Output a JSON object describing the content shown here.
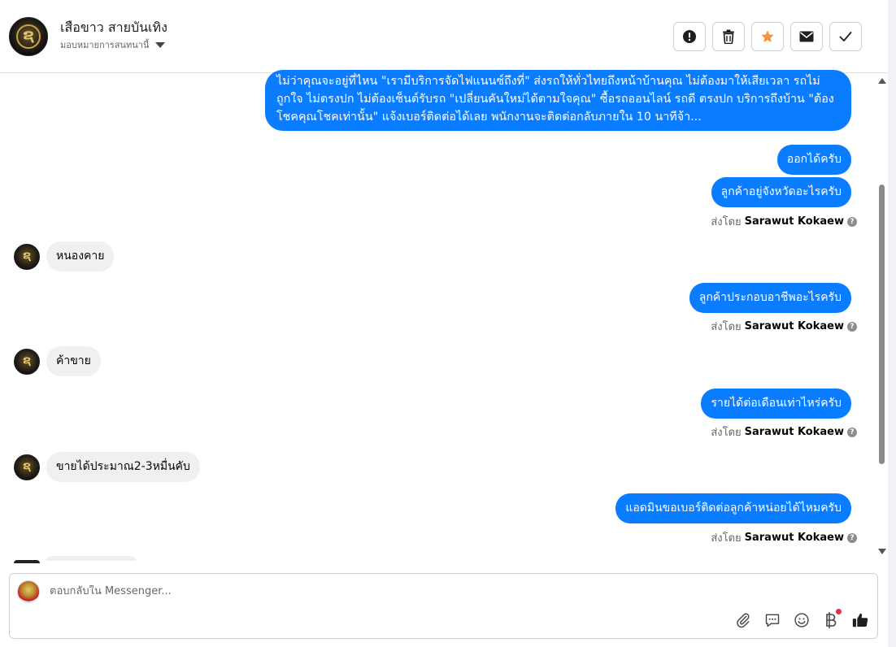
{
  "header": {
    "page_name": "เสือขาว สายบันเทิง",
    "assign_label": "มอบหมายการสนทนานี้",
    "actions": [
      {
        "name": "mark-spam-button",
        "icon": "exclamation-circle-icon"
      },
      {
        "name": "delete-button",
        "icon": "trash-icon"
      },
      {
        "name": "star-button",
        "icon": "star-icon",
        "color": "#f7923a"
      },
      {
        "name": "mark-unread-button",
        "icon": "envelope-icon"
      },
      {
        "name": "mark-done-button",
        "icon": "check-icon"
      }
    ]
  },
  "messages": {
    "long_outgoing": "ไม่ว่าคุณจะอยู่ที่ไหน \"เรามีบริการจัดไฟแนนซ์ถึงที่\"  ส่งรถให้ทั่วไทยถึงหน้าบ้านคุณ ไม่ต้องมาให้เสียเวลา รถไม่ถูกใจ ไม่ตรงปก ไม่ต้องเซ็นต์รับรถ \"เปลี่ยนคันใหม่ได้ตามใจคุณ\" ซื้อรถออนไลน์ รถดี ตรงปก บริการถึงบ้าน \"ต้องโชคคุณโชคเท่านั้น\" แจ้งเบอร์ติดต่อได้เลย พนักงานจะติดต่อกลับภายใน 10 นาทีจ้า...",
    "out_1": "ออกได้ครับ",
    "out_2": "ลูกค้าอยู่จังหวัดอะไรครับ",
    "in_1": "หนองคาย",
    "out_3": "ลูกค้าประกอบอาชีพอะไรครับ",
    "in_2": "ค้าขาย",
    "out_4": "รายได้ต่อเดือนเท่าไหร่ครับ",
    "in_3": "ขายได้ประมาณ2-3หมื่นคับ",
    "out_5": "แอดมินขอเบอร์ติดต่อลูกค้าหน่อยได้ไหมครับ",
    "sent_by_prefix": "ส่งโดย",
    "sent_by_name": "Sarawut Kokaew"
  },
  "composer": {
    "placeholder": "ตอบกลับใน Messenger...",
    "tools": [
      "paperclip-icon",
      "saved-reply-icon",
      "emoji-icon",
      "baht-payment-icon",
      "thumbs-up-icon"
    ]
  },
  "colors": {
    "outgoing_bubble": "#0a7cff",
    "incoming_bubble": "#f0f0f0",
    "star": "#f7923a",
    "notification_dot": "#f02849"
  }
}
